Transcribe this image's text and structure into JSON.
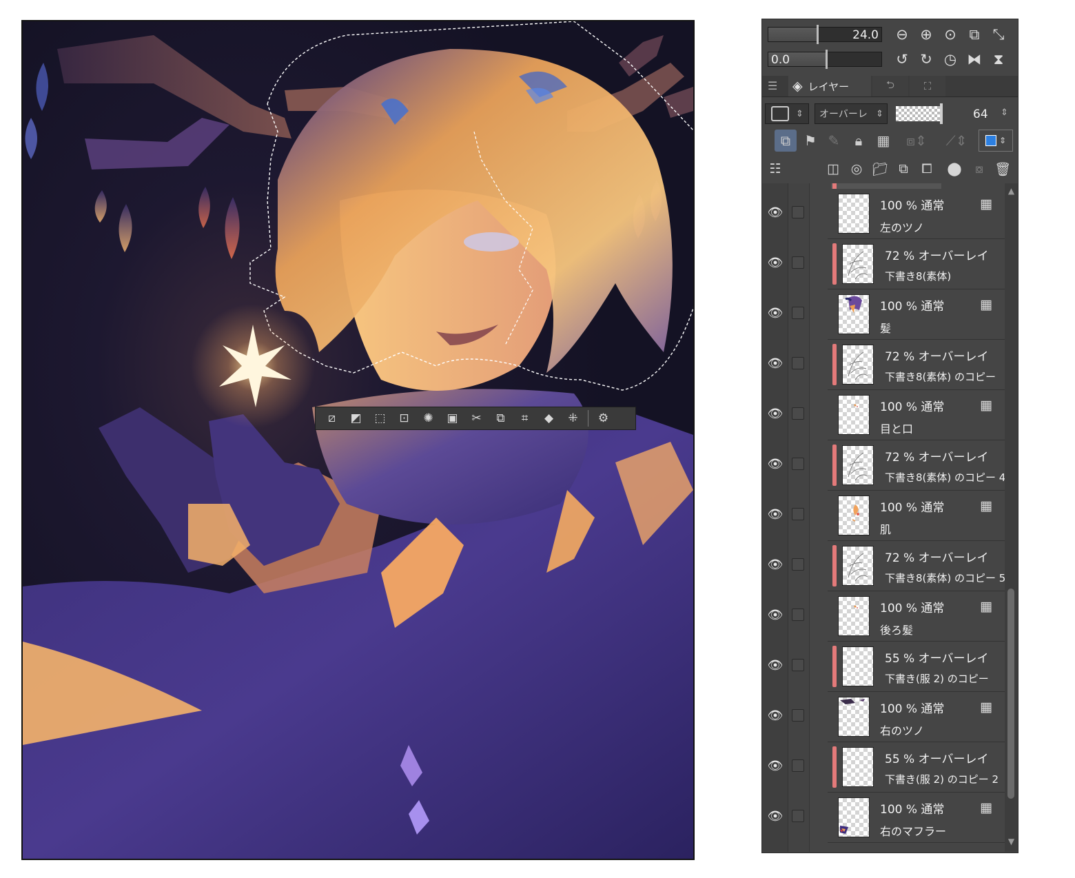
{
  "panel": {
    "brush_size": "24.0",
    "rotation": "0.0",
    "tabs": {
      "layer": "レイヤー",
      "history_icon": "history-icon",
      "navigator_icon": "navigator-icon"
    },
    "blend_mode": "オーバーレ",
    "opacity": "64"
  },
  "layers": [
    {
      "opacity": "100 %",
      "mode": "通常",
      "name": "左のツノ",
      "clipped": false,
      "thumb": "empty"
    },
    {
      "opacity": "72 %",
      "mode": "オーバーレイ",
      "name": "下書き8(素体)",
      "clipped": true,
      "thumb": "sketch"
    },
    {
      "opacity": "100 %",
      "mode": "通常",
      "name": "髪",
      "clipped": false,
      "thumb": "hair"
    },
    {
      "opacity": "72 %",
      "mode": "オーバーレイ",
      "name": "下書き8(素体) のコピー",
      "clipped": true,
      "thumb": "sketch"
    },
    {
      "opacity": "100 %",
      "mode": "通常",
      "name": "目と口",
      "clipped": false,
      "thumb": "dots"
    },
    {
      "opacity": "72 %",
      "mode": "オーバーレイ",
      "name": "下書き8(素体) のコピー 4",
      "clipped": true,
      "thumb": "sketch"
    },
    {
      "opacity": "100 %",
      "mode": "通常",
      "name": "肌",
      "clipped": false,
      "thumb": "skin"
    },
    {
      "opacity": "72 %",
      "mode": "オーバーレイ",
      "name": "下書き8(素体) のコピー 5",
      "clipped": true,
      "thumb": "sketch"
    },
    {
      "opacity": "100 %",
      "mode": "通常",
      "name": "後ろ髪",
      "clipped": false,
      "thumb": "dots"
    },
    {
      "opacity": "55 %",
      "mode": "オーバーレイ",
      "name": "下書き(服 2) のコピー",
      "clipped": true,
      "thumb": "empty"
    },
    {
      "opacity": "100 %",
      "mode": "通常",
      "name": "右のツノ",
      "clipped": false,
      "thumb": "horn"
    },
    {
      "opacity": "55 %",
      "mode": "オーバーレイ",
      "name": "下書き(服 2) のコピー 2",
      "clipped": true,
      "thumb": "empty"
    },
    {
      "opacity": "100 %",
      "mode": "通常",
      "name": "右のマフラー",
      "clipped": false,
      "thumb": "scarf"
    }
  ],
  "colors": {
    "panel_bg": "#454545",
    "clip_marker": "#e47a7a",
    "canvas_bg": "#171327"
  }
}
